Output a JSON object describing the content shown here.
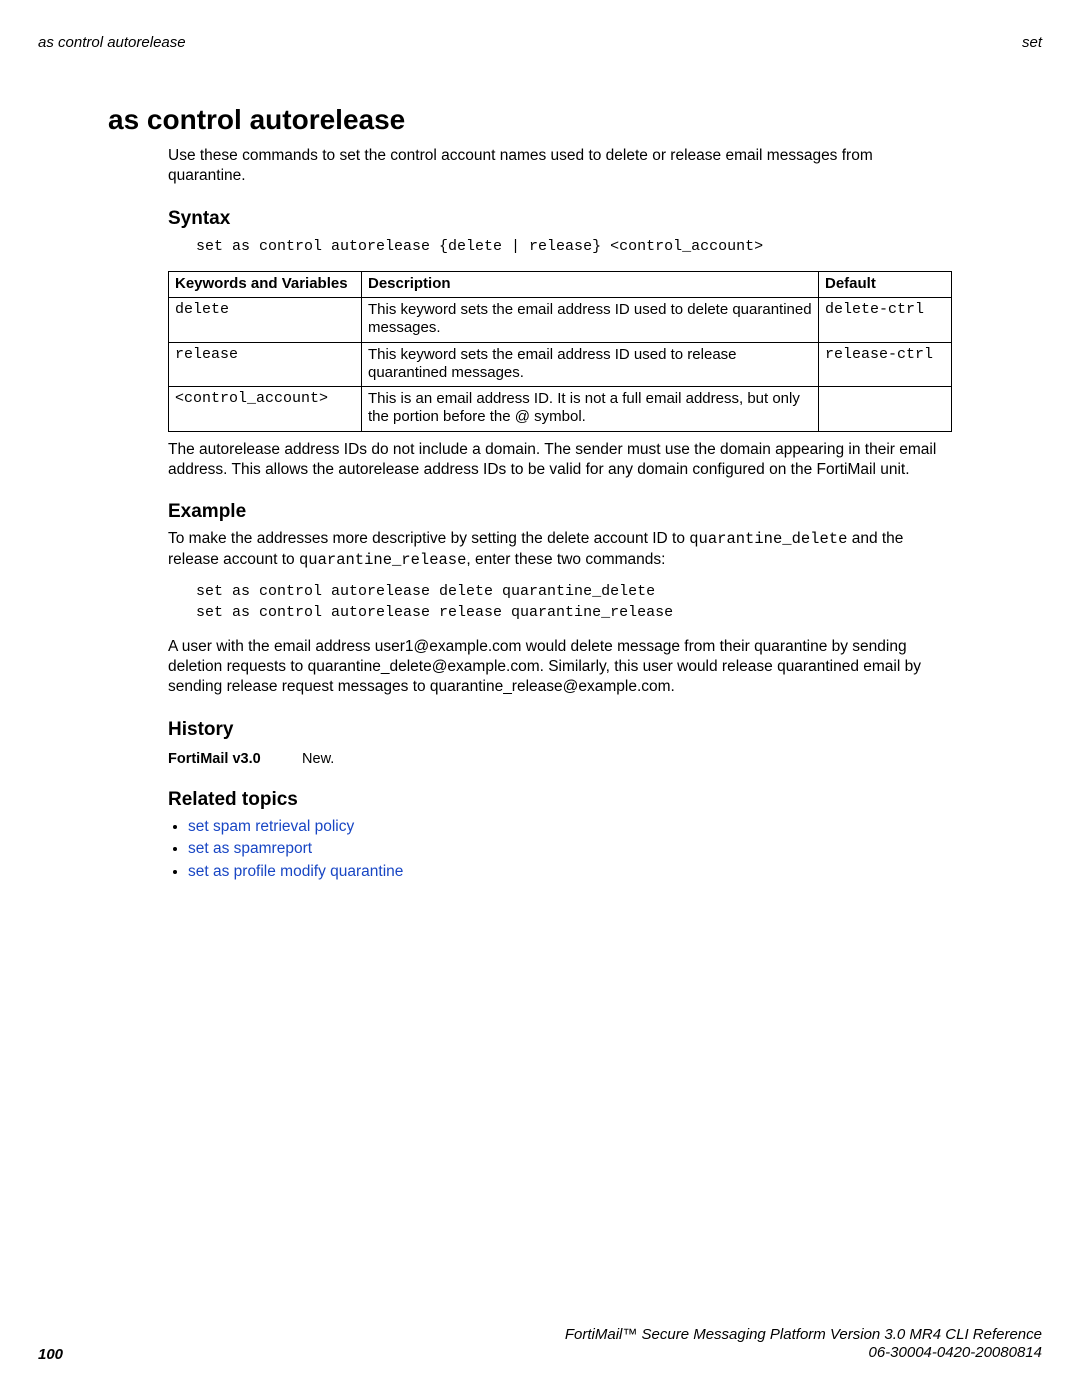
{
  "running_header": {
    "left": "as control autorelease",
    "right": "set"
  },
  "title": "as control autorelease",
  "intro": "Use these commands to set the control account names used to delete or release email messages from quarantine.",
  "syntax": {
    "heading": "Syntax",
    "code": "set as control autorelease {delete | release} <control_account>"
  },
  "table": {
    "headers": {
      "c1": "Keywords and Variables",
      "c2": "Description",
      "c3": "Default"
    },
    "rows": [
      {
        "kw": "delete",
        "desc": "This keyword sets the email address ID used to delete quarantined messages.",
        "def": "delete-ctrl"
      },
      {
        "kw": "release",
        "desc": "This keyword sets the email address ID used to release quarantined messages.",
        "def": "release-ctrl"
      },
      {
        "kw": "<control_account>",
        "desc": "This is an email address ID. It is not a full email address, but only the portion before the @ symbol.",
        "def": ""
      }
    ]
  },
  "post_table_para": "The autorelease address IDs do not include a domain. The sender must use the domain appearing in their email address. This allows the autorelease address IDs to be valid for any domain configured on the FortiMail unit.",
  "example": {
    "heading": "Example",
    "para1_pre": "To make the addresses more descriptive by setting the delete account ID to ",
    "para1_code1": "quarantine_delete",
    "para1_mid": " and the release account to ",
    "para1_code2": "quarantine_release",
    "para1_post": ", enter these two commands:",
    "code": "set as control autorelease delete quarantine_delete\nset as control autorelease release quarantine_release",
    "para2": "A user with the email address user1@example.com would delete message from their quarantine by sending deletion requests to quarantine_delete@example.com. Similarly, this user would release quarantined email by sending release request messages to quarantine_release@example.com."
  },
  "history": {
    "heading": "History",
    "version": "FortiMail v3.0",
    "note": "New."
  },
  "related": {
    "heading": "Related topics",
    "links": [
      "set spam retrieval policy",
      "set as spamreport",
      "set as profile modify quarantine"
    ]
  },
  "footer": {
    "page_number": "100",
    "line1": "FortiMail™ Secure Messaging Platform Version 3.0 MR4 CLI Reference",
    "line2": "06-30004-0420-20080814"
  }
}
